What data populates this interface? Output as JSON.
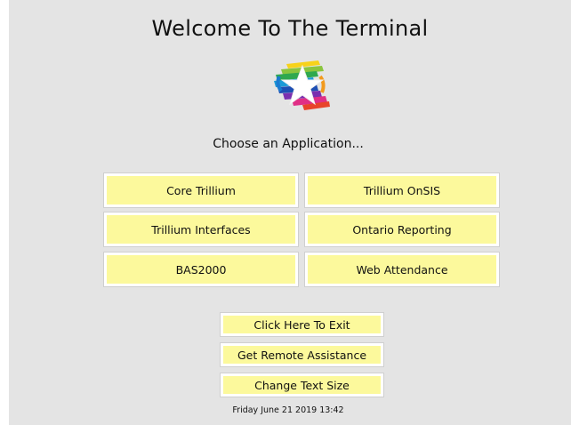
{
  "header": {
    "title": "Welcome To The Terminal"
  },
  "logo": {
    "icon": "rainbow-star-logo-icon"
  },
  "prompt": {
    "text": "Choose an Application..."
  },
  "applications": [
    {
      "label": "Core Trillium"
    },
    {
      "label": "Trillium OnSIS"
    },
    {
      "label": "Trillium Interfaces"
    },
    {
      "label": "Ontario Reporting"
    },
    {
      "label": "BAS2000"
    },
    {
      "label": "Web Attendance"
    }
  ],
  "utilities": {
    "exit_label": "Click Here To Exit",
    "remote_label": "Get Remote Assistance",
    "text_size_label": "Change Text Size"
  },
  "status": {
    "datetime": "Friday June 21 2019 13:42"
  },
  "colors": {
    "background": "#e4e4e4",
    "button_fill": "#fcf99c",
    "button_border": "#ffffff"
  }
}
